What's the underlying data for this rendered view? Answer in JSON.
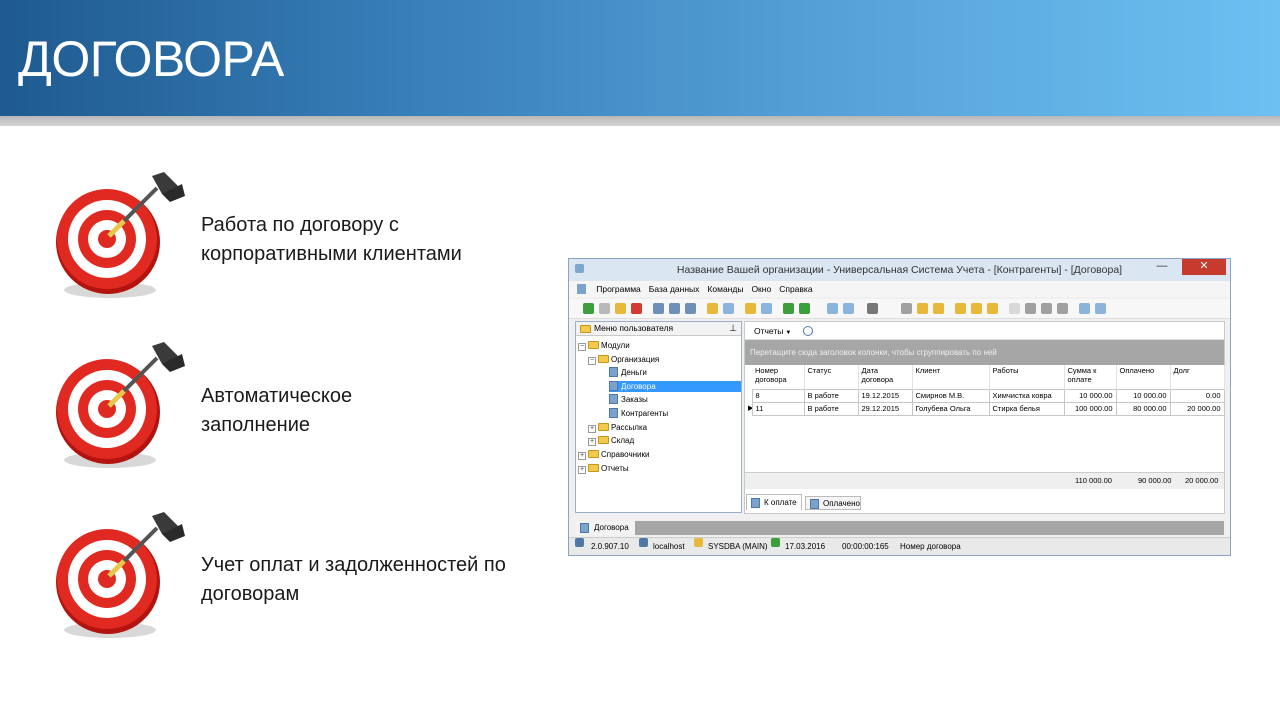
{
  "slide": {
    "title": "ДОГОВОРА",
    "bullets": [
      {
        "text": "Работа по договору с корпоративными клиентами",
        "icon": "target-dart-icon"
      },
      {
        "text": "Автоматическое заполнение",
        "icon": "target-dart-icon"
      },
      {
        "text": "Учет оплат и задолженностей по договорам",
        "icon": "target-dart-icon"
      }
    ]
  },
  "app": {
    "window_title": "Название Вашей организации - Универсальная Система Учета - [Контрагенты] - [Договора]",
    "window_controls": {
      "minimize": "—",
      "maximize": "☐",
      "close": "✕"
    },
    "menu": [
      "Программа",
      "База данных",
      "Команды",
      "Окно",
      "Справка"
    ],
    "left_panel": {
      "header": "Меню пользователя",
      "tree": [
        {
          "label": "Модули",
          "level": 0,
          "type": "folder",
          "expander": "−"
        },
        {
          "label": "Организация",
          "level": 1,
          "type": "folder",
          "expander": "−"
        },
        {
          "label": "Деньги",
          "level": 2,
          "type": "doc"
        },
        {
          "label": "Договора",
          "level": 2,
          "type": "doc",
          "selected": true
        },
        {
          "label": "Заказы",
          "level": 2,
          "type": "doc"
        },
        {
          "label": "Контрагенты",
          "level": 2,
          "type": "doc"
        },
        {
          "label": "Рассылка",
          "level": 1,
          "type": "folder",
          "expander": "+"
        },
        {
          "label": "Склад",
          "level": 1,
          "type": "folder",
          "expander": "+"
        },
        {
          "label": "Справочники",
          "level": 0,
          "type": "folder",
          "expander": "+"
        },
        {
          "label": "Отчеты",
          "level": 0,
          "type": "folder",
          "expander": "+"
        }
      ]
    },
    "right_panel": {
      "reports_label": "Отчеты",
      "group_hint": "Перетащите сюда заголовок колонки, чтобы сгруппировать по ней",
      "columns": [
        "Номер договора",
        "Статус",
        "Дата договора",
        "Клиент",
        "Работы",
        "Сумма к оплате",
        "Оплачено",
        "Долг"
      ],
      "rows": [
        [
          "8",
          "В работе",
          "19.12.2015",
          "Смирнов М.В.",
          "Химчистка ковра",
          "10 000.00",
          "10 000.00",
          "0.00"
        ],
        [
          "11",
          "В работе",
          "29.12.2015",
          "Голубева Ольга",
          "Стирка белья",
          "100 000.00",
          "80 000.00",
          "20 000.00"
        ]
      ],
      "totals": [
        "110 000.00",
        "90 000.00",
        "20 000.00"
      ],
      "tabs": [
        "К оплате",
        "Оплачено"
      ]
    },
    "bottom_tab": "Договора",
    "status": {
      "version": "2.0.907.10",
      "host": "localhost",
      "user": "SYSDBA (MAIN)",
      "date": "17.03.2016",
      "timer": "00:00:00:165",
      "field": "Номер договора"
    }
  },
  "colors": {
    "header_dark": "#1e5a8f",
    "header_light": "#6cc0f2",
    "target_red": "#d9231c",
    "selection": "#3399ff"
  }
}
